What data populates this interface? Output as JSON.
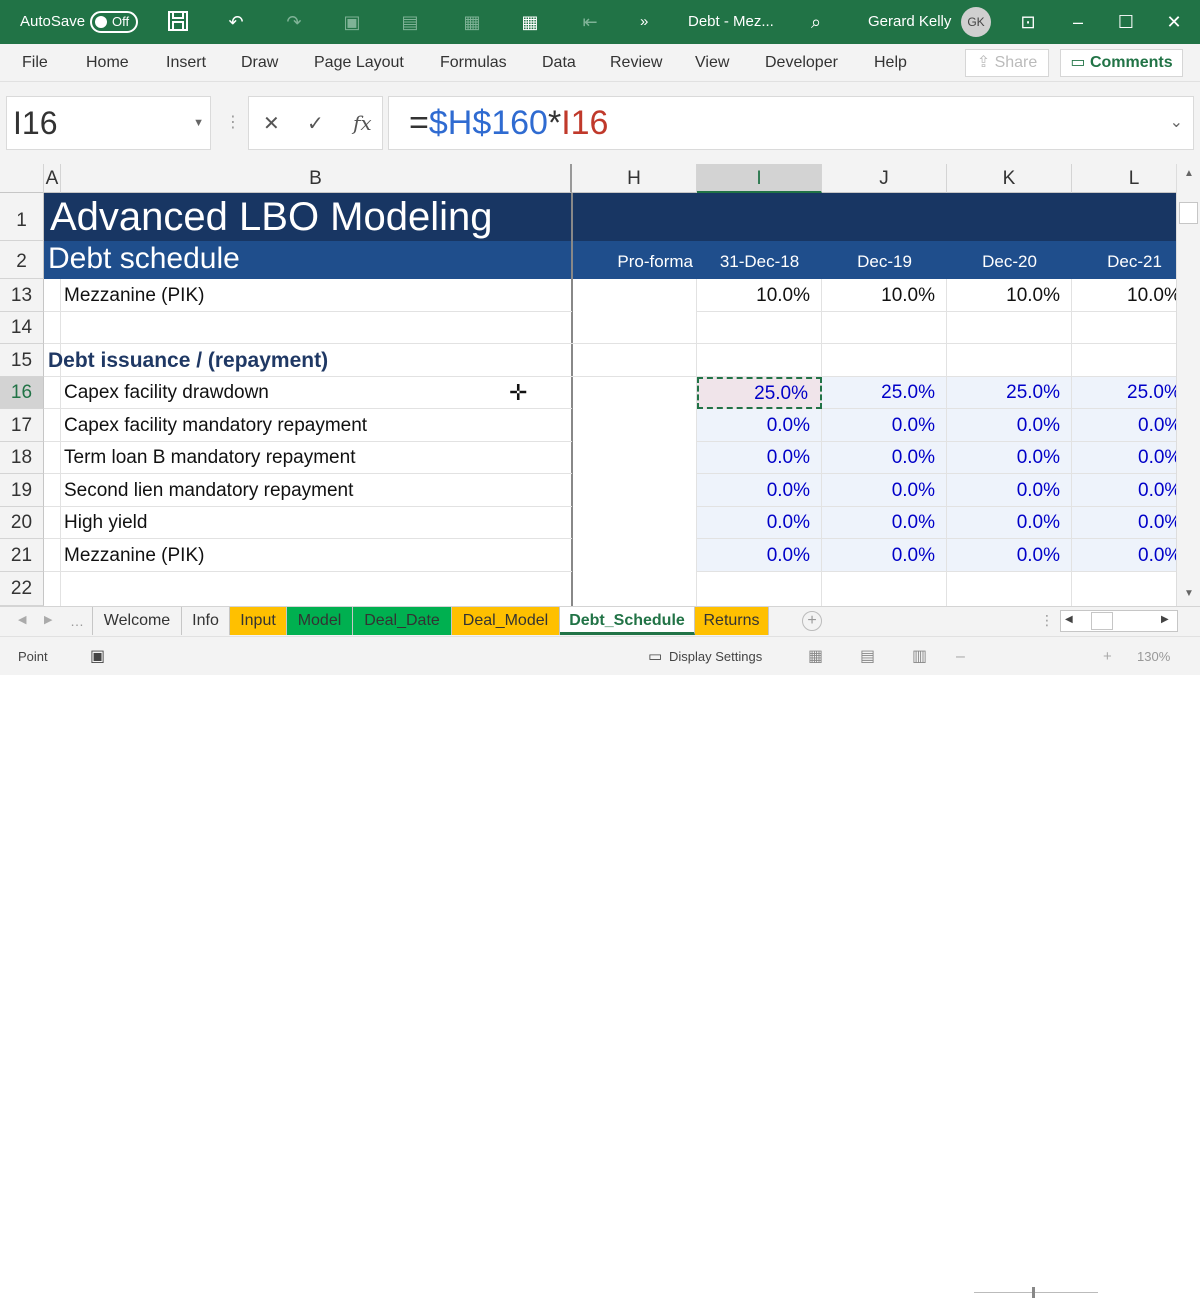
{
  "titlebar": {
    "autosave_label": "AutoSave",
    "autosave_state": "Off",
    "doc_title": "Debt - Mez...",
    "more": "»",
    "user_name": "Gerard Kelly",
    "user_initials": "GK"
  },
  "menu": [
    "File",
    "Home",
    "Insert",
    "Draw",
    "Page Layout",
    "Formulas",
    "Data",
    "Review",
    "View",
    "Developer",
    "Help"
  ],
  "share_label": "Share",
  "comments_label": "Comments",
  "formula_bar": {
    "name_box": "I16",
    "eq": "=",
    "ref1": "$H$160",
    "op": "*",
    "ref2": "I16"
  },
  "columns": [
    "A",
    "B",
    "H",
    "I",
    "J",
    "K",
    "L"
  ],
  "sheet": {
    "title": "Advanced LBO Modeling",
    "subtitle": "Debt schedule",
    "headers": [
      "Pro-forma",
      "31-Dec-18",
      "Dec-19",
      "Dec-20",
      "Dec-21"
    ],
    "rows": [
      {
        "num": "1"
      },
      {
        "num": "2"
      },
      {
        "num": "13",
        "label": "Mezzanine (PIK)",
        "values": [
          "10.0%",
          "10.0%",
          "10.0%",
          "10.0%"
        ],
        "style": "black"
      },
      {
        "num": "14"
      },
      {
        "num": "15",
        "label": "Debt issuance / (repayment)",
        "style": "section"
      },
      {
        "num": "16",
        "label": "Capex facility drawdown",
        "values": [
          "25.0%",
          "25.0%",
          "25.0%",
          "25.0%"
        ],
        "style": "blue"
      },
      {
        "num": "17",
        "label": "Capex facility mandatory repayment",
        "values": [
          "0.0%",
          "0.0%",
          "0.0%",
          "0.0%"
        ],
        "style": "blue"
      },
      {
        "num": "18",
        "label": "Term loan B mandatory repayment",
        "values": [
          "0.0%",
          "0.0%",
          "0.0%",
          "0.0%"
        ],
        "style": "blue"
      },
      {
        "num": "19",
        "label": "Second lien mandatory repayment",
        "values": [
          "0.0%",
          "0.0%",
          "0.0%",
          "0.0%"
        ],
        "style": "blue"
      },
      {
        "num": "20",
        "label": "High yield",
        "values": [
          "0.0%",
          "0.0%",
          "0.0%",
          "0.0%"
        ],
        "style": "blue"
      },
      {
        "num": "21",
        "label": "Mezzanine (PIK)",
        "values": [
          "0.0%",
          "0.0%",
          "0.0%",
          "0.0%"
        ],
        "style": "blue"
      },
      {
        "num": "22"
      }
    ]
  },
  "tabs": [
    {
      "label": "Welcome",
      "color": "none"
    },
    {
      "label": "Info",
      "color": "none"
    },
    {
      "label": "Input",
      "color": "orange"
    },
    {
      "label": "Model",
      "color": "green"
    },
    {
      "label": "Deal_Date",
      "color": "green"
    },
    {
      "label": "Deal_Model",
      "color": "orange"
    },
    {
      "label": "Debt_Schedule",
      "color": "active"
    },
    {
      "label": "Returns",
      "color": "orange"
    }
  ],
  "status": {
    "mode": "Point",
    "display_settings": "Display Settings",
    "zoom": "130%"
  },
  "colors": {
    "excel_green": "#217346",
    "title_navy": "#183663",
    "subtitle_blue": "#1f4e8c",
    "section_text": "#1f3864",
    "input_blue": "#0000c8",
    "tab_orange": "#ffc000",
    "tab_green": "#00b050"
  }
}
